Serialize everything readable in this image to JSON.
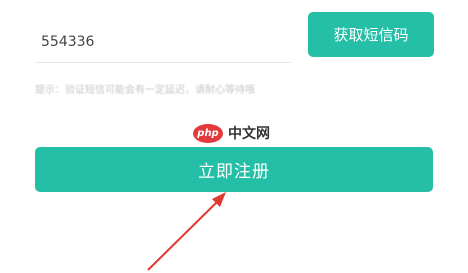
{
  "form": {
    "code_value": "554336",
    "sms_button_label": "获取短信码",
    "hint_text": "提示：验证短信可能会有一定延迟，请耐心等待哦",
    "register_button_label": "立即注册"
  },
  "watermark": {
    "badge": "php",
    "text": "中文网"
  },
  "colors": {
    "accent": "#25bfa7",
    "arrow": "#e0392f",
    "watermark_red": "#e4393c"
  },
  "icons": {
    "annotation_arrow": "arrow-icon"
  }
}
